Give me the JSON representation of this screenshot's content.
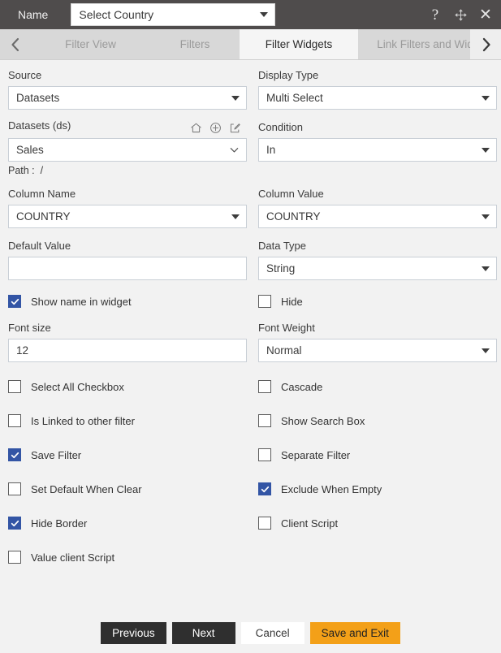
{
  "titlebar": {
    "name_label": "Name",
    "name_value": "Select Country",
    "name_placeholder": "Select Country",
    "icons": {
      "help": "?",
      "move": "move-icon",
      "close": "✕"
    }
  },
  "tabs": {
    "prev_arrow": "chevron-left",
    "next_arrow": "chevron-right",
    "items": [
      {
        "label": "Filter View",
        "active": false
      },
      {
        "label": "Filters",
        "active": false
      },
      {
        "label": "Filter Widgets",
        "active": true
      },
      {
        "label": "Link Filters and Widge",
        "active": false
      }
    ]
  },
  "form": {
    "source": {
      "label": "Source",
      "value": "Datasets"
    },
    "display_type": {
      "label": "Display Type",
      "value": "Multi Select"
    },
    "datasets": {
      "label": "Datasets (ds)",
      "value": "Sales",
      "icons": [
        "home-icon",
        "plus-circle-icon",
        "edit-icon"
      ]
    },
    "condition": {
      "label": "Condition",
      "value": "In"
    },
    "path": {
      "label": "Path :",
      "value": "/"
    },
    "column_name": {
      "label": "Column Name",
      "value": "COUNTRY"
    },
    "column_value": {
      "label": "Column Value",
      "value": "COUNTRY"
    },
    "default_value": {
      "label": "Default Value",
      "value": "",
      "placeholder": ""
    },
    "data_type": {
      "label": "Data Type",
      "value": "String"
    },
    "font_size": {
      "label": "Font size",
      "value": "12"
    },
    "font_weight": {
      "label": "Font Weight",
      "value": "Normal"
    }
  },
  "checkboxes": {
    "top": [
      {
        "label": "Show name in widget",
        "checked": true
      },
      {
        "label": "Hide",
        "checked": false
      }
    ],
    "grid": [
      [
        {
          "label": "Select All Checkbox",
          "checked": false
        },
        {
          "label": "Cascade",
          "checked": false
        }
      ],
      [
        {
          "label": "Is Linked to other filter",
          "checked": false
        },
        {
          "label": "Show Search Box",
          "checked": false
        }
      ],
      [
        {
          "label": "Save Filter",
          "checked": true
        },
        {
          "label": "Separate Filter",
          "checked": false
        }
      ],
      [
        {
          "label": "Set Default When Clear",
          "checked": false
        },
        {
          "label": "Exclude When Empty",
          "checked": true
        }
      ],
      [
        {
          "label": "Hide Border",
          "checked": true
        },
        {
          "label": "Client Script",
          "checked": false
        }
      ],
      [
        {
          "label": "Value client Script",
          "checked": false
        },
        {
          "label": "",
          "checked": false
        }
      ]
    ]
  },
  "footer": {
    "previous": "Previous",
    "next": "Next",
    "cancel": "Cancel",
    "save_and_exit": "Save and Exit"
  },
  "colors": {
    "titlebar": "#4f4c4c",
    "background": "#f2f2f2",
    "tabbar": "#d8d8d8",
    "active_tab": "#f5f5f5",
    "checkbox_checked": "#3355a5",
    "accent_button": "#f3a018",
    "dark_button": "#2f2f2f"
  }
}
